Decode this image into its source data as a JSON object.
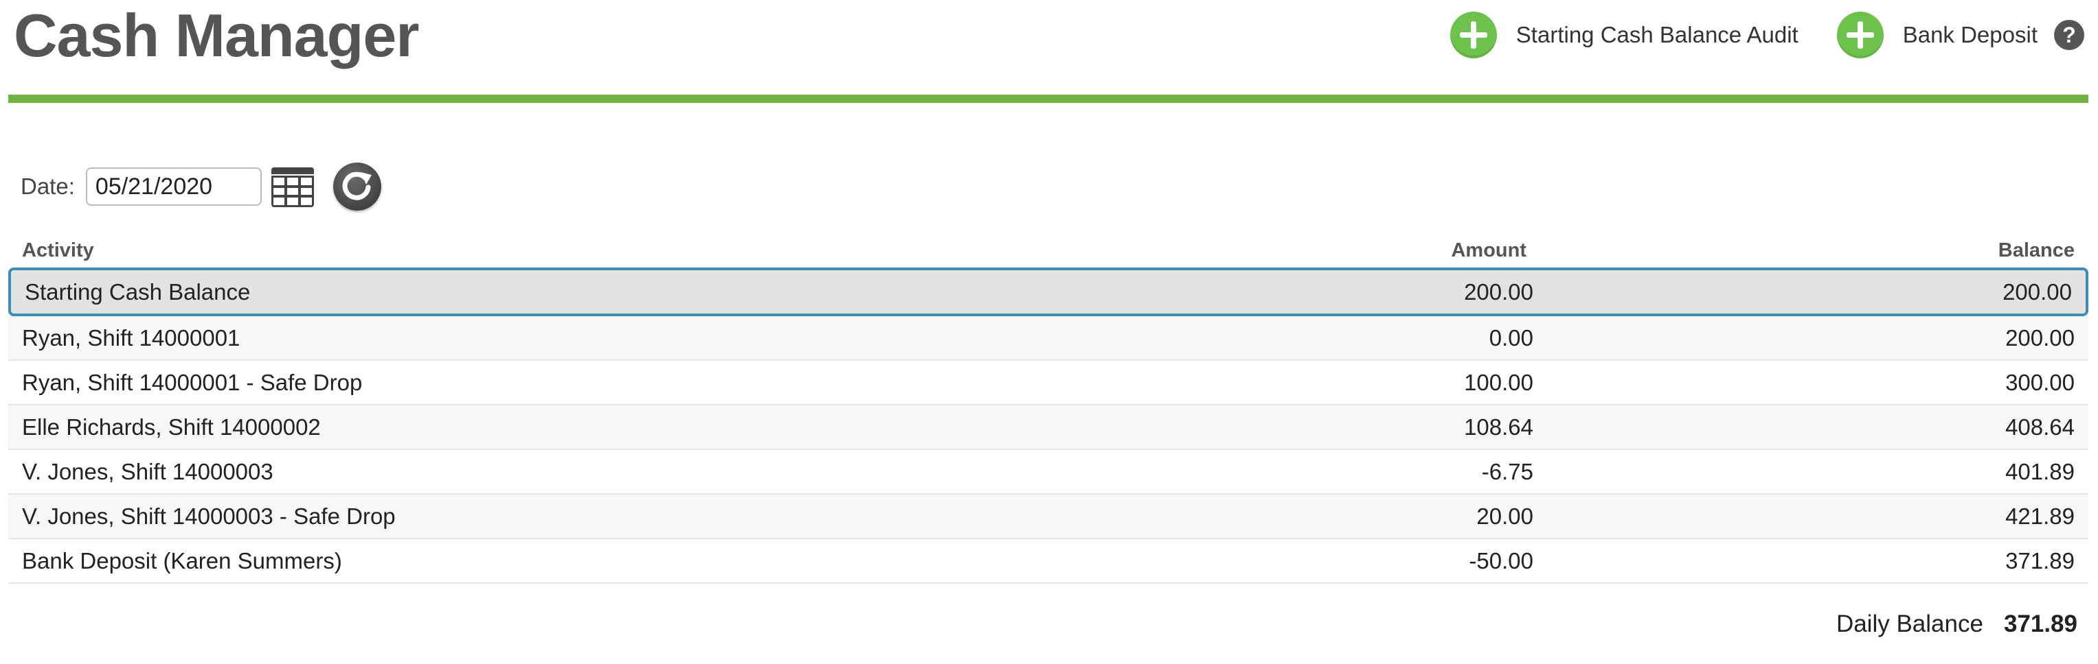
{
  "page": {
    "title": "Cash Manager"
  },
  "actions": {
    "starting_audit_label": "Starting Cash Balance Audit",
    "bank_deposit_label": "Bank Deposit",
    "help_glyph": "?"
  },
  "filter": {
    "date_label": "Date:",
    "date_value": "05/21/2020"
  },
  "table": {
    "columns": {
      "activity": "Activity",
      "amount": "Amount",
      "balance": "Balance"
    },
    "rows": [
      {
        "activity": "Starting Cash Balance",
        "amount": "200.00",
        "balance": "200.00"
      },
      {
        "activity": "Ryan, Shift 14000001",
        "amount": "0.00",
        "balance": "200.00"
      },
      {
        "activity": "Ryan, Shift 14000001 - Safe Drop",
        "amount": "100.00",
        "balance": "300.00"
      },
      {
        "activity": "Elle Richards, Shift 14000002",
        "amount": "108.64",
        "balance": "408.64"
      },
      {
        "activity": "V. Jones, Shift 14000003",
        "amount": "-6.75",
        "balance": "401.89"
      },
      {
        "activity": "V. Jones, Shift 14000003 - Safe Drop",
        "amount": "20.00",
        "balance": "421.89"
      },
      {
        "activity": "Bank Deposit (Karen Summers)",
        "amount": "-50.00",
        "balance": "371.89"
      }
    ]
  },
  "summary": {
    "daily_balance_label": "Daily Balance",
    "daily_balance_value": "371.89"
  },
  "colors": {
    "accent_green": "#6cb33f",
    "plus_green": "#6cc24a",
    "selection_border": "#3a8fb7"
  },
  "icons": {
    "add": "plus-circle-icon",
    "calendar": "calendar-icon",
    "refresh": "refresh-icon",
    "help": "help-icon"
  }
}
